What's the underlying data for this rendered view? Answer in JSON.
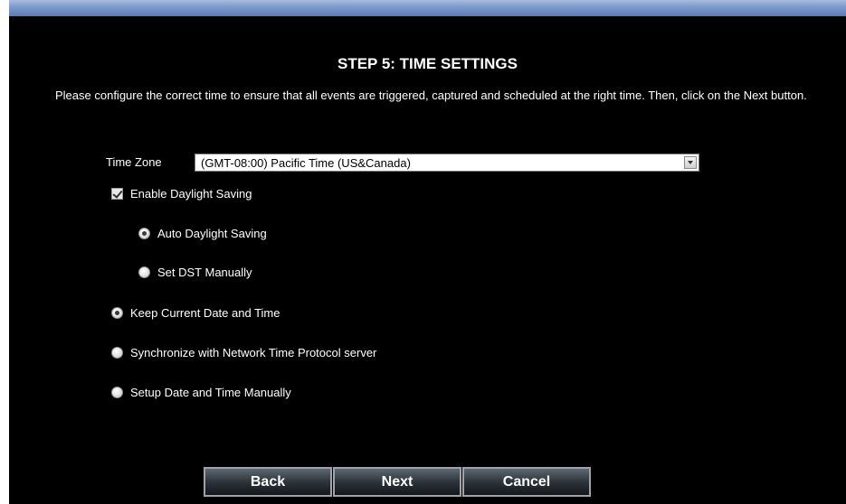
{
  "page": {
    "title": "STEP 5: TIME SETTINGS",
    "intro": "Please configure the correct time to ensure that all events are triggered, captured and scheduled at the right time. Then, click on the Next button."
  },
  "time_zone": {
    "label": "Time Zone",
    "selected": "(GMT-08:00) Pacific Time (US&Canada)"
  },
  "daylight_saving": {
    "enable_label": "Enable Daylight Saving",
    "enabled": true,
    "auto_label": "Auto Daylight Saving",
    "manual_label": "Set DST Manually",
    "mode": "auto"
  },
  "time_source": {
    "options": [
      {
        "label": "Keep Current Date and Time",
        "selected": true
      },
      {
        "label": "Synchronize with Network Time Protocol server",
        "selected": false
      },
      {
        "label": "Setup Date and Time Manually",
        "selected": false
      }
    ]
  },
  "buttons": {
    "back": "Back",
    "next": "Next",
    "cancel": "Cancel"
  },
  "colors": {
    "background": "#000000",
    "text": "#ffffff",
    "header_strip": "#7f9ccc"
  }
}
